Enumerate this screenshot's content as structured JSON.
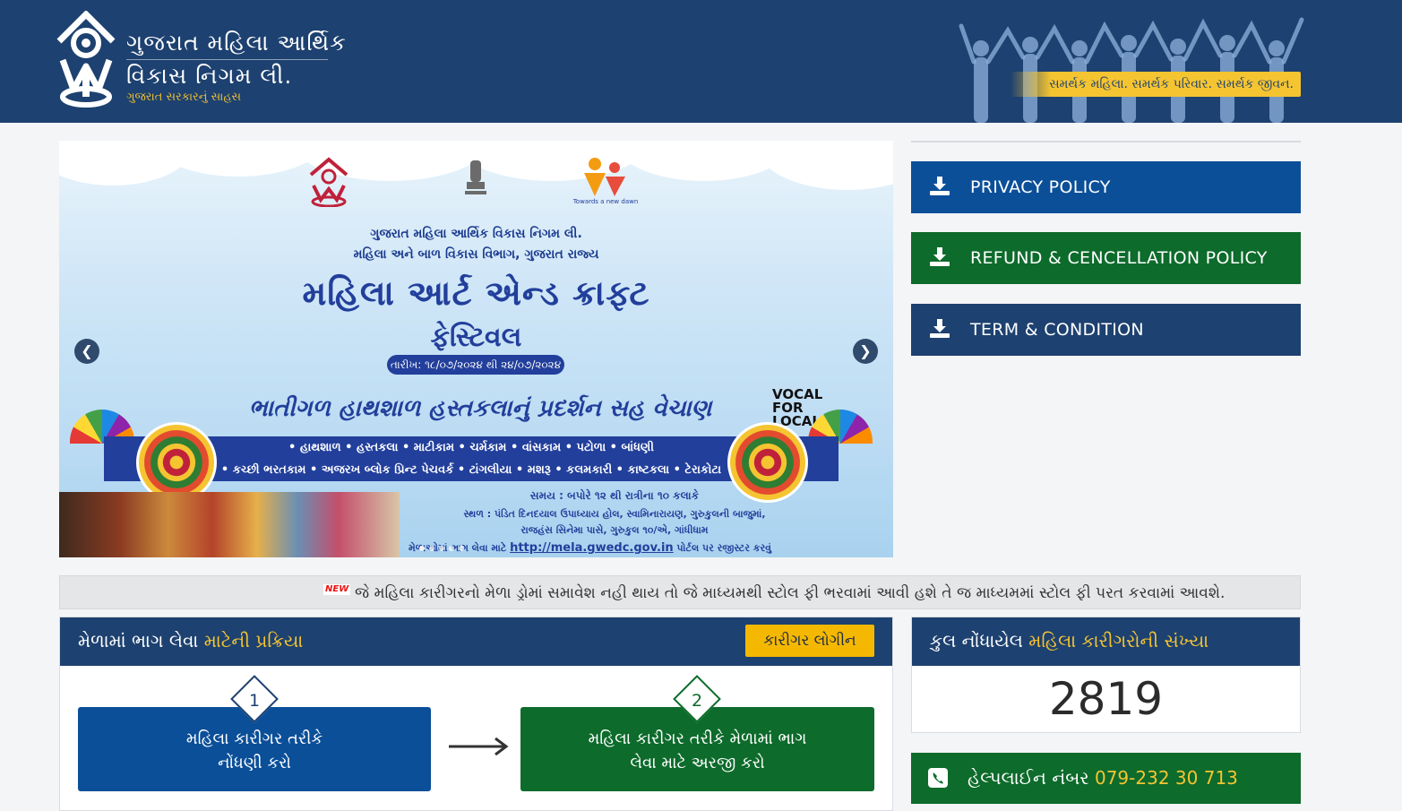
{
  "header": {
    "brand_line1": "ગુજરાત મહિલા આર્થિક",
    "brand_line2": "વિકાસ નિગમ લી.",
    "brand_sub": "ગુજરાત સરકારનું સાહસ",
    "tagline": "સમર્થક મહિલા. સમર્થક પરિવાર. સમર્થક જીવન."
  },
  "banner": {
    "org_line1": "ગુજરાત મહિલા આર્થિક વિકાસ નિગમ લી.",
    "org_line2": "મહિલા અને બાળ વિકાસ વિભાગ, ગુજરાત રાજ્ય",
    "title1": "મહિલા આર્ટ એન્ડ ક્રાફ્ટ",
    "title2": "ફેસ્ટિવલ",
    "date": "તારીખ: ૧૮/૦૭/૨૦૨૪ થી ૨૪/૦૭/૨૦૨૪",
    "exhibition": "ભાતીગળ હાથશાળ હસ્તકલાનું પ્રદર્શન સહ વેચાણ",
    "vocal": "VOCAL FOR LOCAL",
    "towards_logo": "Towards a new dawn",
    "crafts_line1": "• હાથશાળ • હસ્તકલા • માટીકામ • ચર્મકામ • વાંસકામ • પટોળા • બાંધણી",
    "crafts_line2": "• કચ્છી ભરતકામ • અજરખ બ્લોક પ્રિન્ટ પેચવર્ક • ટાંગલીયા • મશરૂ • કલમકારી • કાષ્ટકલા • ટેરાકોટા",
    "time": "સમય : બપોરે ૧૨ થી રાત્રીના ૧૦ કલાકે",
    "venue1": "સ્થળ : પંડિત દિનદયાલ ઉપાધ્યાય હોલ, સ્વામિનારાયણ, ગુરુકુલની બાજુમાં,",
    "venue2": "રાજહંસ સિનેમા પાસે, ગુરુકુલ ૧૦/એ, ગાંધીધામ",
    "portal_pre": "મેળાઓમાં ભાગ લેવા માટે",
    "portal_url": "http://mela.gwedc.gov.in",
    "portal_post": "પોર્ટલ પર રજીસ્ટર કરવું",
    "prev_arrow": "❮",
    "next_arrow": "❯"
  },
  "policies": [
    {
      "label": "PRIVACY POLICY",
      "color": "#0b4f99",
      "icon": "download-icon"
    },
    {
      "label": "REFUND & CENCELLATION POLICY",
      "color": "#0d6b2b",
      "icon": "download-icon"
    },
    {
      "label": "TERM & CONDITION",
      "color": "#1d4170",
      "icon": "download-icon"
    }
  ],
  "notice": {
    "badge": "NEW",
    "text": "જે મહિલા કારીગરનો મેળા ડ્રોમાં સમાવેશ નહી થાય તો જે માધ્યમથી સ્ટોલ ફી ભરવામાં આવી હશે તે જ માધ્યમમાં સ્ટોલ ફી પરત કરવામાં આવશે."
  },
  "process": {
    "title_plain": "મેળામાં ભાગ લેવા ",
    "title_highlight": "માટેની પ્રક્રિયા",
    "login_label": "કારીગર લોગીન",
    "steps": [
      {
        "num": "1",
        "line1": "મહિલા કારીગર તરીકે",
        "line2": "નોંધણી કરો",
        "color": "#0b4f99"
      },
      {
        "num": "2",
        "line1": "મહિલા કારીગર તરીકે મેળામાં ભાગ",
        "line2": "લેવા માટે અરજી કરો",
        "color": "#0d6b2b"
      }
    ]
  },
  "count": {
    "title_plain": "કુલ નોંધાયેલ ",
    "title_highlight": "મહિલા કારીગરોની સંખ્યા",
    "value": "2819"
  },
  "helpline": {
    "label": "હેલ્પલાઈન નંબર ",
    "number": "079-232 30 713"
  },
  "colors": {
    "navy": "#1d4170",
    "blue": "#0b4f99",
    "green": "#0d6b2b",
    "gold": "#f5c431"
  }
}
